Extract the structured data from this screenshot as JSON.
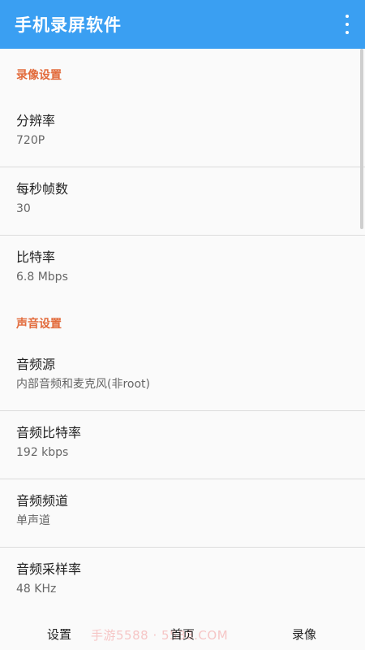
{
  "app": {
    "title": "手机录屏软件"
  },
  "sections": {
    "video": {
      "header": "录像设置",
      "items": [
        {
          "title": "分辨率",
          "summary": "720P"
        },
        {
          "title": "每秒帧数",
          "summary": "30"
        },
        {
          "title": "比特率",
          "summary": "6.8 Mbps"
        }
      ]
    },
    "audio": {
      "header": "声音设置",
      "items": [
        {
          "title": "音频源",
          "summary": "内部音频和麦克风(非root)"
        },
        {
          "title": "音频比特率",
          "summary": "192 kbps"
        },
        {
          "title": "音频频道",
          "summary": "单声道"
        },
        {
          "title": "音频采样率",
          "summary": "48 KHz"
        }
      ]
    }
  },
  "bottom_nav": {
    "settings": "设置",
    "home": "首页",
    "record": "录像",
    "watermark": "手游5588 · 5588.COM"
  },
  "colors": {
    "appbar": "#3a9ff2",
    "section_header": "#e26b3c"
  }
}
